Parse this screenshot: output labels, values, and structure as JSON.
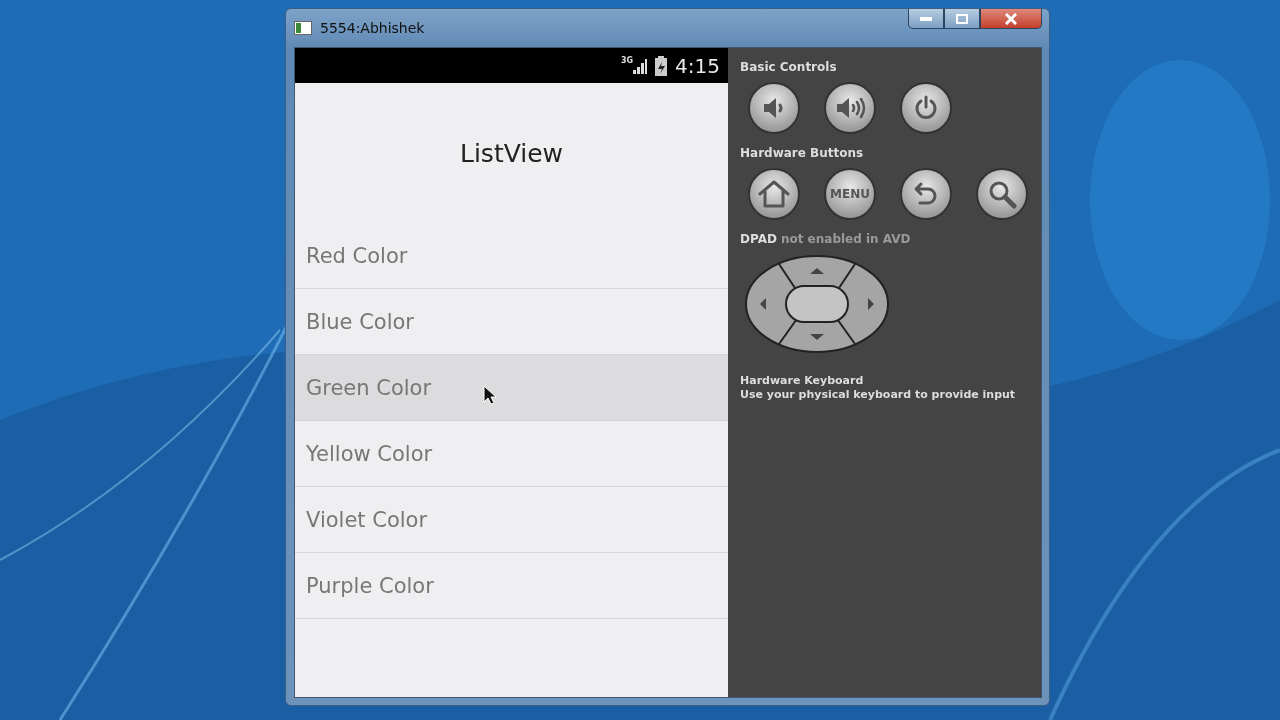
{
  "window": {
    "title": "5554:Abhishek"
  },
  "status_bar": {
    "network": "3G",
    "time": "4:15"
  },
  "app": {
    "title": "ListView",
    "items": [
      {
        "label": "Red Color",
        "selected": false
      },
      {
        "label": "Blue Color",
        "selected": false
      },
      {
        "label": "Green Color",
        "selected": true
      },
      {
        "label": "Yellow Color",
        "selected": false
      },
      {
        "label": "Violet Color",
        "selected": false
      },
      {
        "label": "Purple Color",
        "selected": false
      }
    ]
  },
  "controls": {
    "basic": {
      "title": "Basic Controls",
      "buttons": [
        {
          "kind": "volume-down"
        },
        {
          "kind": "volume-up"
        },
        {
          "kind": "power"
        }
      ]
    },
    "hardware": {
      "title": "Hardware Buttons",
      "buttons": [
        {
          "kind": "home"
        },
        {
          "kind": "menu",
          "label": "MENU"
        },
        {
          "kind": "back"
        },
        {
          "kind": "search"
        }
      ]
    },
    "dpad": {
      "name": "DPAD",
      "note": "not enabled in AVD"
    },
    "keyboard": {
      "title": "Hardware Keyboard",
      "description": "Use your physical keyboard to provide input"
    }
  }
}
